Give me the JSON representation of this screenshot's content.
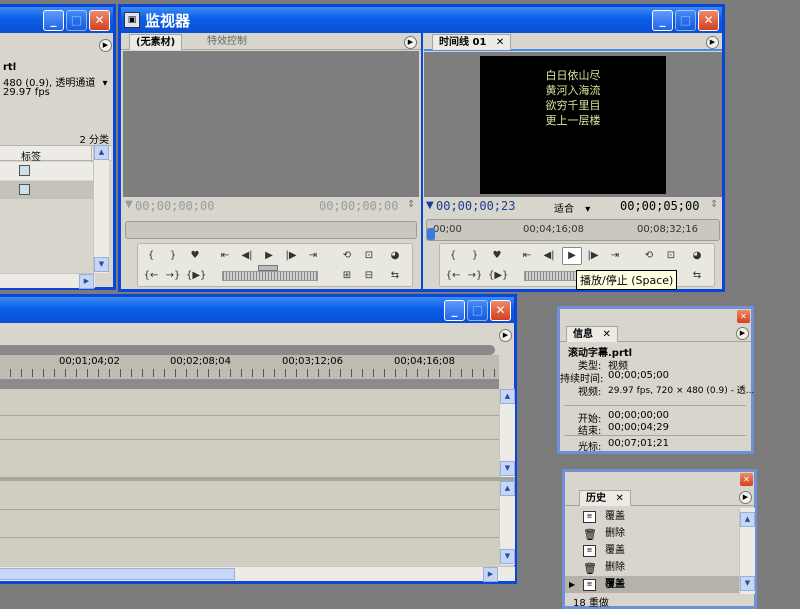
{
  "project_win": {
    "file_suffix": "rtl",
    "spec_line": "480 (0.9), 透明通道",
    "fps": "29.97 fps",
    "count": "2 分类",
    "col_label": "标签"
  },
  "monitor": {
    "title": "监视器",
    "source_tab": "(无素材)",
    "effects_tab": "特效控制",
    "timeline_tab": "时间线 01",
    "source_tc_left": "00;00;00;00",
    "source_tc_right": "00;00;00;00",
    "prog_tc_current": "00;00;00;23",
    "fit_label": "适合",
    "prog_tc_duration": "00;00;05;00",
    "ruler_labels": [
      "00;00",
      "00;04;16;08",
      "00;08;32;16"
    ],
    "tooltip": "播放/停止 (Space)",
    "poem_lines": [
      "白日依山尽",
      "黄河入海流",
      "欲穷千里目",
      "更上一层楼"
    ]
  },
  "timeline_win": {
    "ruler_labels": [
      "00;01;04;02",
      "00;02;08;04",
      "00;03;12;06",
      "00;04;16;08"
    ]
  },
  "info": {
    "tab": "信息",
    "clip_name": "滚动字幕.prtl",
    "type_label": "类型:",
    "type_value": "视频",
    "duration_label": "持续时间:",
    "duration_value": "00;00;05;00",
    "video_label": "视频:",
    "video_value": "29.97 fps, 720 × 480 (0.9) - 透...",
    "start_label": "开始:",
    "start_value": "00;00;00;00",
    "end_label": "结束:",
    "end_value": "00;00;04;29",
    "cursor_label": "光标:",
    "cursor_value": "00;07;01;21"
  },
  "history": {
    "tab": "历史",
    "items": [
      "覆盖",
      "删除",
      "覆盖",
      "删除",
      "覆盖"
    ],
    "bottom": "18 重做"
  },
  "colors": {
    "titlebar": "#0a5ee8",
    "panel": "#d8d6cc",
    "desktop": "#7b7b7b",
    "timecode": "#1a3c9a"
  }
}
